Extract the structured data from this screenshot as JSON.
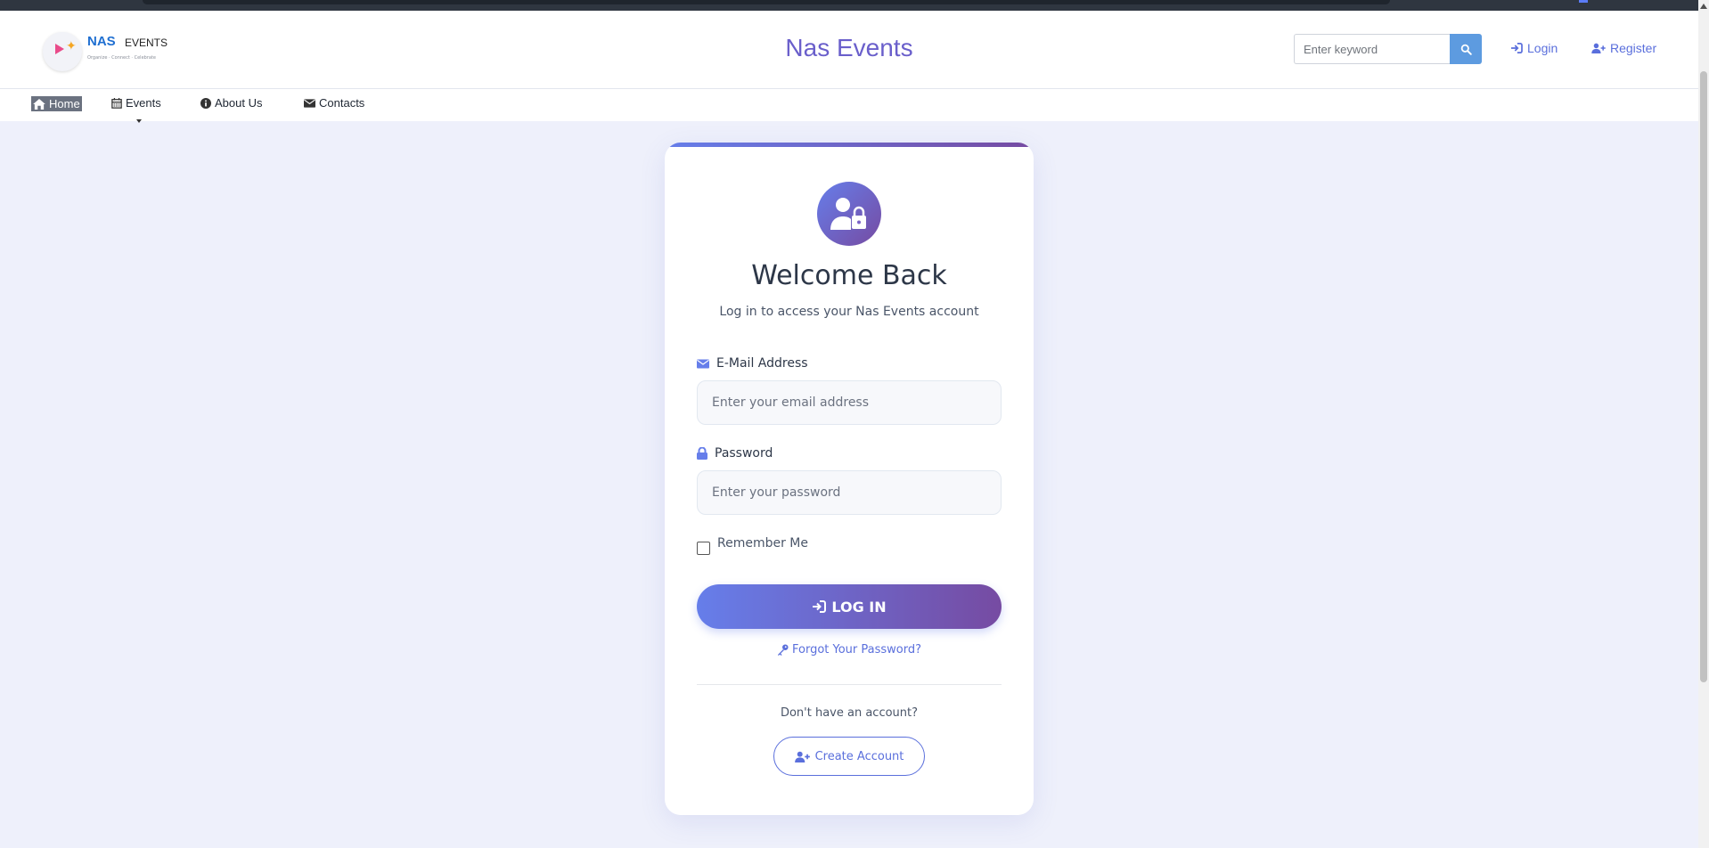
{
  "brand": {
    "logo_main": "NAS",
    "logo_sub": "EVENTS",
    "logo_tagline": "Organize · Connect · Celebrate",
    "site_title": "Nas Events"
  },
  "header": {
    "search_placeholder": "Enter keyword",
    "login_label": "Login",
    "register_label": "Register"
  },
  "nav": {
    "items": [
      {
        "label": "Home",
        "icon": "home-icon",
        "active": true
      },
      {
        "label": "Events",
        "icon": "calendar-icon",
        "dropdown": true
      },
      {
        "label": "About Us",
        "icon": "info-icon"
      },
      {
        "label": "Contacts",
        "icon": "envelope-icon"
      }
    ]
  },
  "login_card": {
    "title": "Welcome Back",
    "subtitle": "Log in to access your Nas Events account",
    "email_label": "E-Mail Address",
    "email_placeholder": "Enter your email address",
    "password_label": "Password",
    "password_placeholder": "Enter your password",
    "remember_label": "Remember Me",
    "login_button": "LOG IN",
    "forgot_link": "Forgot Your Password?",
    "no_account_text": "Don't have an account?",
    "create_account_button": "Create Account"
  },
  "colors": {
    "accent": "#667eea",
    "accent_end": "#764ba2",
    "link": "#5a6fdc",
    "search_button": "#5d9be0",
    "page_bg": "#eef0fb"
  }
}
